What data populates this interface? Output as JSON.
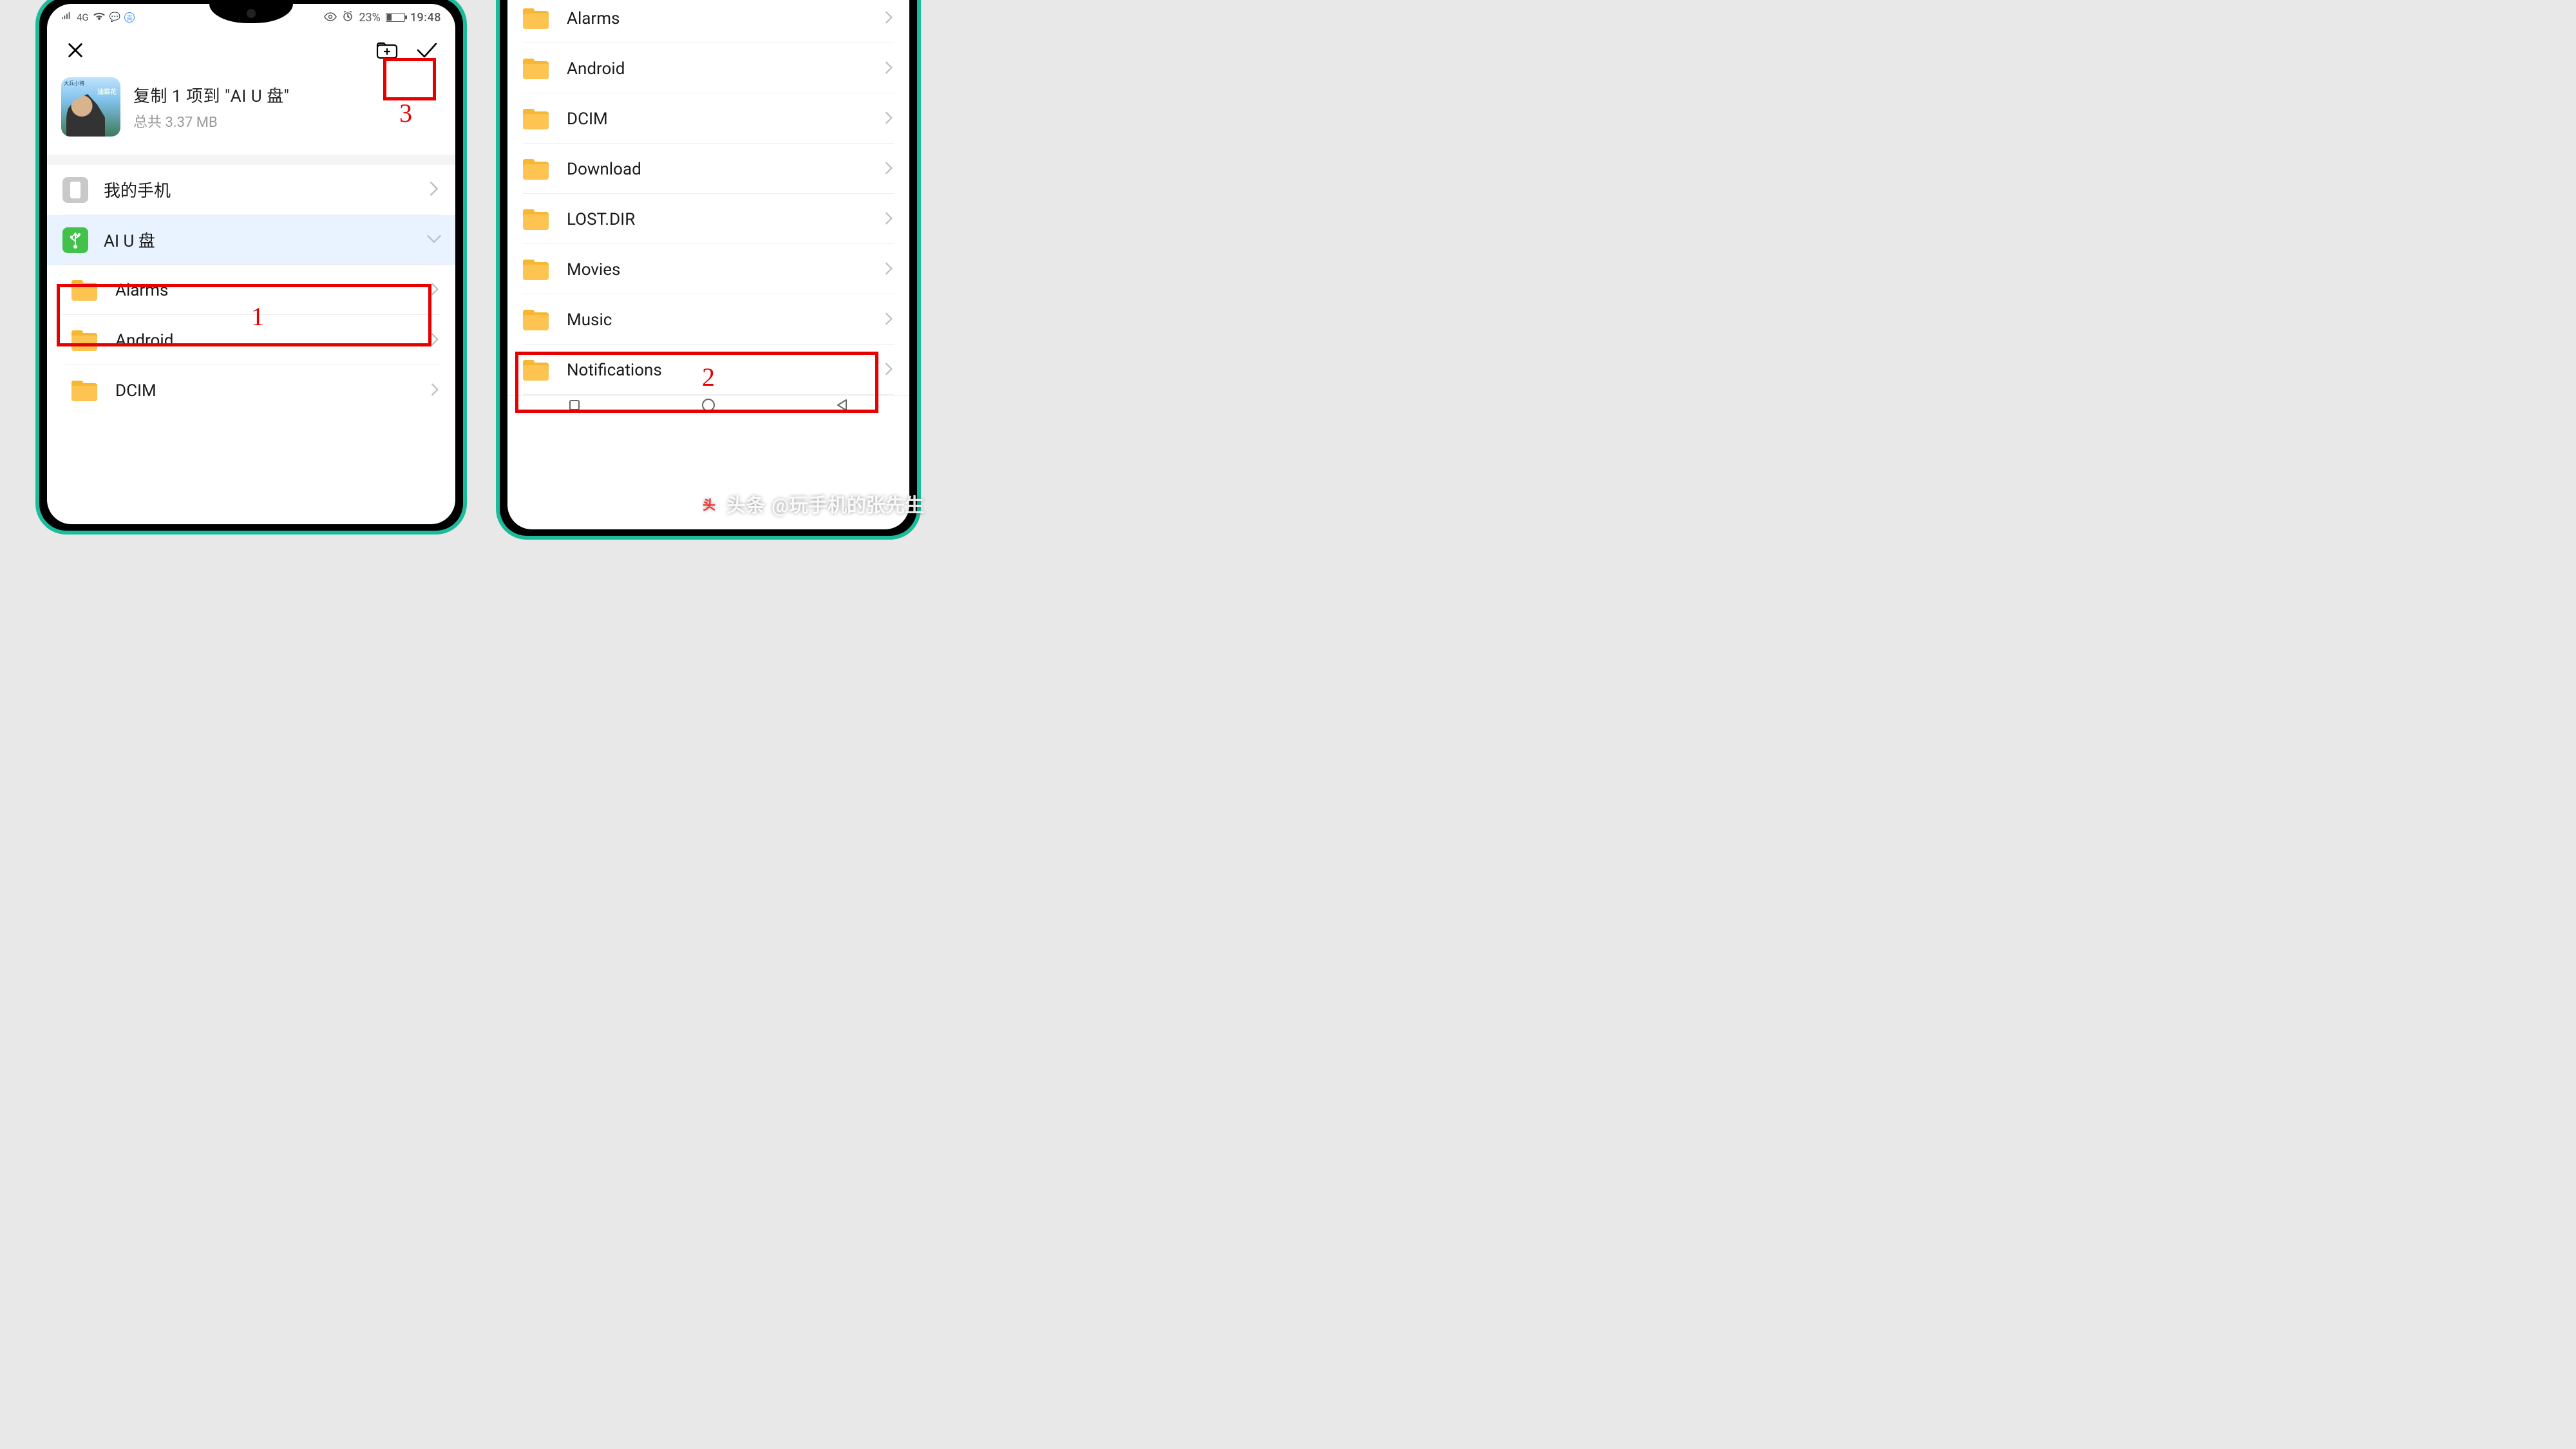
{
  "statusbar": {
    "network": "4G",
    "battery_pct": "23%",
    "time": "19:48"
  },
  "toolbar": {
    "close_icon": "close",
    "new_folder_icon": "new-folder",
    "confirm_icon": "check"
  },
  "copy_card": {
    "title": "复制 1 项到 \"AI U 盘\"",
    "subtitle": "总共 3.37 MB",
    "thumb_top": "大兵小将",
    "thumb_side": "油菜花"
  },
  "destinations": {
    "my_phone": "我的手机",
    "usb": "AI U 盘"
  },
  "folders_left": [
    "Alarms",
    "Android",
    "DCIM"
  ],
  "folders_right": [
    "Alarms",
    "Android",
    "DCIM",
    "Download",
    "LOST.DIR",
    "Movies",
    "Music",
    "Notifications"
  ],
  "steps": {
    "one": "1",
    "two": "2",
    "three": "3"
  },
  "watermark": {
    "brand": "头条",
    "handle": "@玩手机的张先生"
  }
}
